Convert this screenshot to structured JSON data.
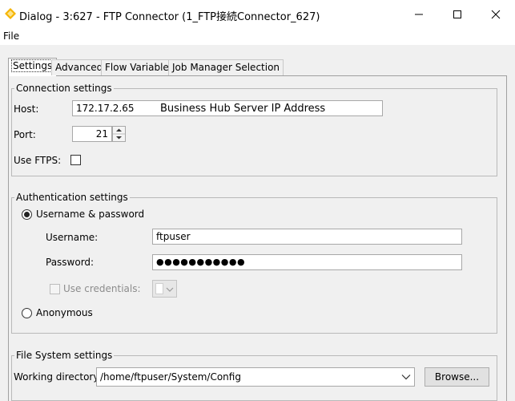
{
  "window": {
    "title": "Dialog - 3:627 - FTP Connector (1_FTP接続Connector_627)",
    "minimize_icon": "minimize-icon",
    "maximize_icon": "maximize-icon",
    "close_icon": "close-icon"
  },
  "menu": {
    "file": "File"
  },
  "tabs": [
    {
      "label": "Settings",
      "active": true
    },
    {
      "label": "Advanced",
      "active": false
    },
    {
      "label": "Flow Variables",
      "active": false
    },
    {
      "label": "Job Manager Selection",
      "active": false
    }
  ],
  "connection": {
    "group_title": "Connection settings",
    "host_label": "Host:",
    "host_value": "172.17.2.65",
    "host_annotation": "Business Hub Server IP Address",
    "port_label": "Port:",
    "port_value": "21",
    "ftps_label": "Use FTPS:"
  },
  "auth": {
    "group_title": "Authentication settings",
    "userpass_label": "Username & password",
    "username_label": "Username:",
    "username_value": "ftpuser",
    "password_label": "Password:",
    "password_value": "●●●●●●●●●●●",
    "credentials_label": "Use credentials:",
    "anonymous_label": "Anonymous"
  },
  "filesystem": {
    "group_title": "File System settings",
    "workdir_label": "Working directory:",
    "workdir_value": "/home/ftpuser/System/Config",
    "browse_label": "Browse..."
  }
}
